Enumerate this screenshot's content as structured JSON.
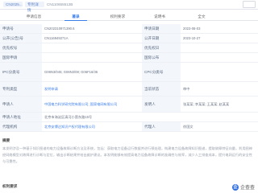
{
  "header": {
    "chip_1": "CN2025...",
    "chip_2": "专利详情",
    "id_text": "CN110655512B"
  },
  "tabs": [
    "申请信息",
    "著录",
    "权利要求",
    "说明书",
    "全文"
  ],
  "fields": {
    "r1": {
      "label": "申请号",
      "value": "CN202310971390.6",
      "label2": "申请日期",
      "value2": "2023-08-03"
    },
    "r2": {
      "label": "公开(公告)号",
      "value": "CN116949271A",
      "label2": "公开日期",
      "value2": "2023-10-27"
    },
    "r3": {
      "label": "优先权号",
      "value": "",
      "label2": "优先权日",
      "value2": ""
    },
    "r4": {
      "label": "国际申请",
      "value": "",
      "label2": "国际公布",
      "value2": ""
    },
    "r5": {
      "label": "IPC分类号",
      "value": "G06N3/045; G06N3/08; G06F16/36",
      "label2": "CPC分类号",
      "value2": ""
    },
    "r6": {
      "label": "专利类型",
      "value": "发明申请",
      "label2": "当前状态",
      "value2": "审中"
    },
    "r7": {
      "label": "申请人",
      "value": "中国电力科学研究院有限公司; 国家电网有限公司",
      "label2": "发明人",
      "value2": "张某某; 李某某; 王某某; 赵某某"
    },
    "r8": {
      "label": "申请人地址",
      "value": "北京市海淀区清河小营东路15号"
    },
    "r9": {
      "label": "代理机构",
      "value": "北京安博达知识产权代理有限公司",
      "label2": "代理人",
      "value2": "徐国文"
    }
  },
  "summary": {
    "title": "摘要",
    "text": "本发明涉及一种基于知识图谱的电力设备故障诊断方法及系统，包括：获取电力设备运行数据并进行预处理，构建电力设备故障知识图谱，提取故障特征向量，利用图神经网络模型对故障进行诊断与定位，输出诊断结果并给出维护建议。本发明能够有效提高电力设备故障诊断的准确性与效率，减少人工排查成本，提升电网运行的安全性与可靠性。"
  },
  "footer": {
    "title": "权利要求",
    "brand": "企查查"
  }
}
